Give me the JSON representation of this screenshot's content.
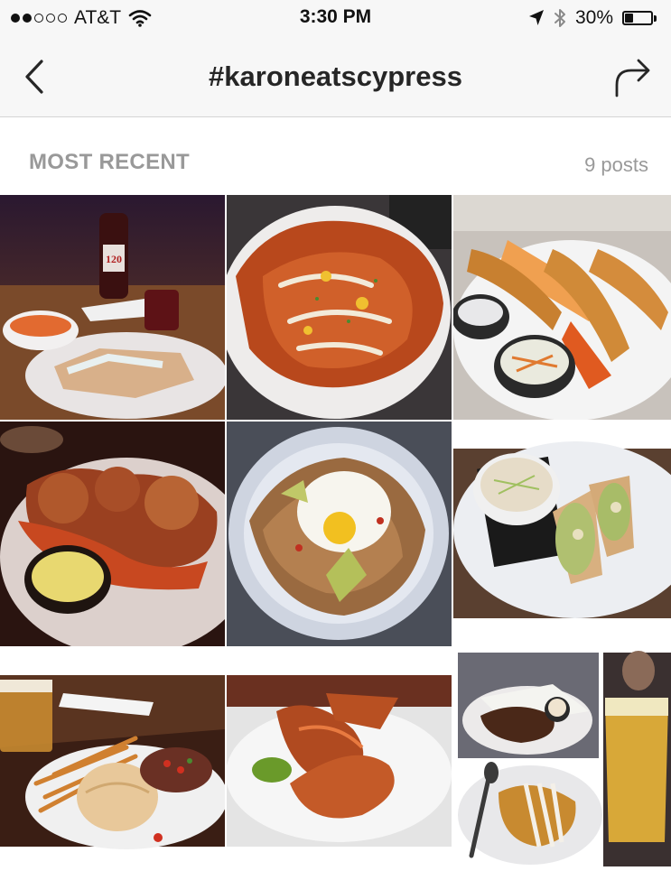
{
  "status_bar": {
    "carrier": "AT&T",
    "signal_bars_filled": 2,
    "signal_bars_total": 5,
    "time": "3:30 PM",
    "battery_percent": "30%",
    "battery_level": 0.3
  },
  "nav": {
    "title": "#karoneatscypress",
    "back_icon": "chevron-left-icon",
    "share_icon": "share-arrow-icon"
  },
  "section": {
    "label": "MOST RECENT",
    "post_count": "9 posts"
  },
  "photos": [
    {
      "name": "photo-quesadilla-wine",
      "subject": "quesadilla with sweet potato fries and red wine"
    },
    {
      "name": "photo-loaded-waffle-fries",
      "subject": "loaded waffle fries"
    },
    {
      "name": "photo-fish-and-chips",
      "subject": "fried fish with waffle fries and coleslaw"
    },
    {
      "name": "photo-chicken-tenders",
      "subject": "fried chicken with sweet potato tots and sauce"
    },
    {
      "name": "photo-fried-egg-hash",
      "subject": "hash topped with fried egg and avocado"
    },
    {
      "name": "photo-wrap-coleslaw",
      "subject": "wrap with coleslaw"
    },
    {
      "name": "photo-burger-fries-beer",
      "subject": "burger with fries and beer"
    },
    {
      "name": "photo-fried-chicken-plate",
      "subject": "fried chicken with green sauce"
    },
    {
      "name": "photo-collage-beer",
      "subject": "collage of wings, pasta and beer"
    }
  ],
  "wine_label_text": "120"
}
